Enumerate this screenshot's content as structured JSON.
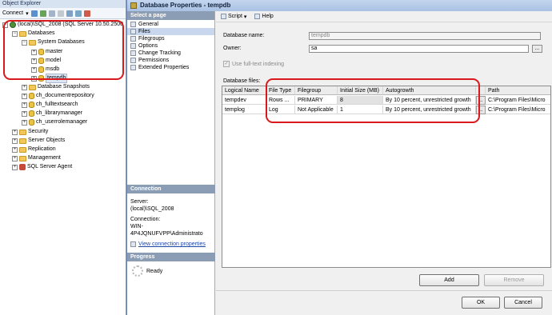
{
  "object_explorer": {
    "title": "Object Explorer",
    "toolbar_connect": "Connect",
    "tree": {
      "server": "(local)\\SQL_2008 (SQL Server 10.50.2500",
      "databases": "Databases",
      "system_databases": "System Databases",
      "system_items": [
        "master",
        "model",
        "msdb",
        "tempdb"
      ],
      "snapshots": "Database Snapshots",
      "user_dbs": [
        "ch_documentrepository",
        "ch_fulltextsearch",
        "ch_librarymanager",
        "ch_userrolemanager"
      ],
      "security": "Security",
      "server_objects": "Server Objects",
      "replication": "Replication",
      "management": "Management",
      "agent": "SQL Server Agent"
    }
  },
  "dialog": {
    "title": "Database Properties - tempdb",
    "select_page": "Select a page",
    "pages": [
      "General",
      "Files",
      "Filegroups",
      "Options",
      "Change Tracking",
      "Permissions",
      "Extended Properties"
    ],
    "connection_head": "Connection",
    "server_label": "Server:",
    "server_value": "(local)\\SQL_2008",
    "connection_label": "Connection:",
    "connection_value": "WIN-4P4JQNUFVPP\\Administrato",
    "view_link": "View connection properties",
    "progress_head": "Progress",
    "progress_status": "Ready",
    "toolbar_script": "Script",
    "toolbar_help": "Help",
    "db_name_label": "Database name:",
    "db_name_value": "tempdb",
    "owner_label": "Owner:",
    "owner_value": "sa",
    "fulltext_label": "Use full-text indexing",
    "db_files_label": "Database files:",
    "columns": [
      "Logical Name",
      "File Type",
      "Filegroup",
      "Initial Size (MB)",
      "Autogrowth",
      "",
      "Path"
    ],
    "rows": [
      [
        "tempdev",
        "Rows ...",
        "PRIMARY",
        "8",
        "By 10 percent, unrestricted growth",
        "...",
        "C:\\Program Files\\Micro"
      ],
      [
        "templog",
        "Log",
        "Not Applicable",
        "1",
        "By 10 percent, unrestricted growth",
        "...",
        "C:\\Program Files\\Micro"
      ]
    ],
    "add_button": "Add",
    "remove_button": "Remove",
    "ok_button": "OK",
    "cancel_button": "Cancel"
  },
  "colors": {
    "highlight_outline": "#d9191c",
    "pane_header": "#8a9db4",
    "title_bar": "#b5cbe9"
  }
}
